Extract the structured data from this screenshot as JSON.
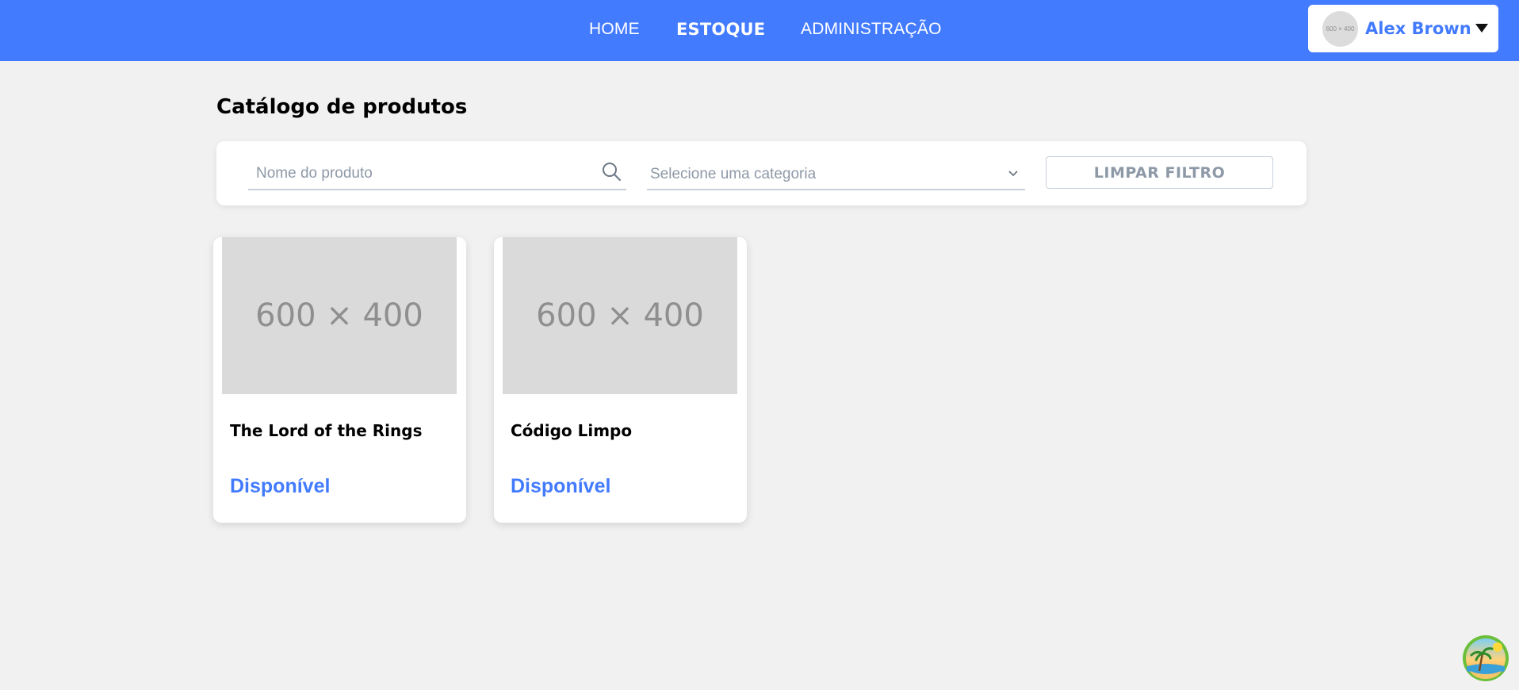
{
  "nav": {
    "items": [
      {
        "label": "HOME",
        "active": false
      },
      {
        "label": "ESTOQUE",
        "active": true
      },
      {
        "label": "ADMINISTRAÇÃO",
        "active": false
      }
    ]
  },
  "user": {
    "avatar_text": "600 × 400",
    "name": "Alex Brown"
  },
  "page": {
    "title": "Catálogo de produtos"
  },
  "filters": {
    "search_placeholder": "Nome do produto",
    "search_value": "",
    "category_placeholder": "Selecione uma categoria",
    "clear_label": "LIMPAR FILTRO"
  },
  "products": [
    {
      "image_text": "600 × 400",
      "name": "The Lord of the Rings",
      "status": "Disponível"
    },
    {
      "image_text": "600 × 400",
      "name": "Código Limpo",
      "status": "Disponível"
    }
  ],
  "colors": {
    "primary": "#437bff",
    "background": "#f1f1f1",
    "muted": "#8e99a7"
  }
}
